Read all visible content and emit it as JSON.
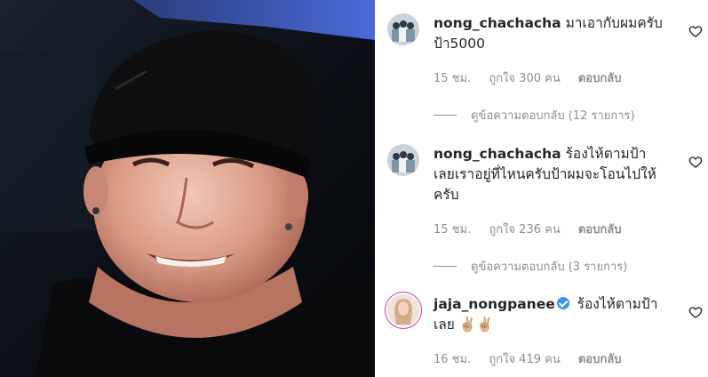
{
  "comments": [
    {
      "username": "nong_chachacha",
      "text": "มาเอากับผมครับป้า5000",
      "time": "15 ชม.",
      "likes": "ถูกใจ 300 คน",
      "reply_label": "ตอบกลับ",
      "view_replies": "ดูข้อความตอบกลับ (12 รายการ)"
    },
    {
      "username": "nong_chachacha",
      "text": "ร้องไห้ตามป้าเลยเราอยู่ที่ไหนครับป้าผมจะโอนไปให้ครับ",
      "time": "15 ชม.",
      "likes": "ถูกใจ 236 คน",
      "reply_label": "ตอบกลับ",
      "view_replies": "ดูข้อความตอบกลับ (3 รายการ)"
    },
    {
      "username": "jaja_nongpanee",
      "text": "ร้องไห้ตามป้าเลย ✌🏼✌🏼",
      "time": "16 ชม.",
      "likes": "ถูกใจ 419 คน",
      "reply_label": "ตอบกลับ"
    }
  ],
  "icons": {
    "heart": "heart-outline-icon",
    "verified": "verified-badge-icon"
  },
  "colors": {
    "meta_text": "#8e8e8e",
    "verified": "#3897f0",
    "text": "#262626"
  }
}
